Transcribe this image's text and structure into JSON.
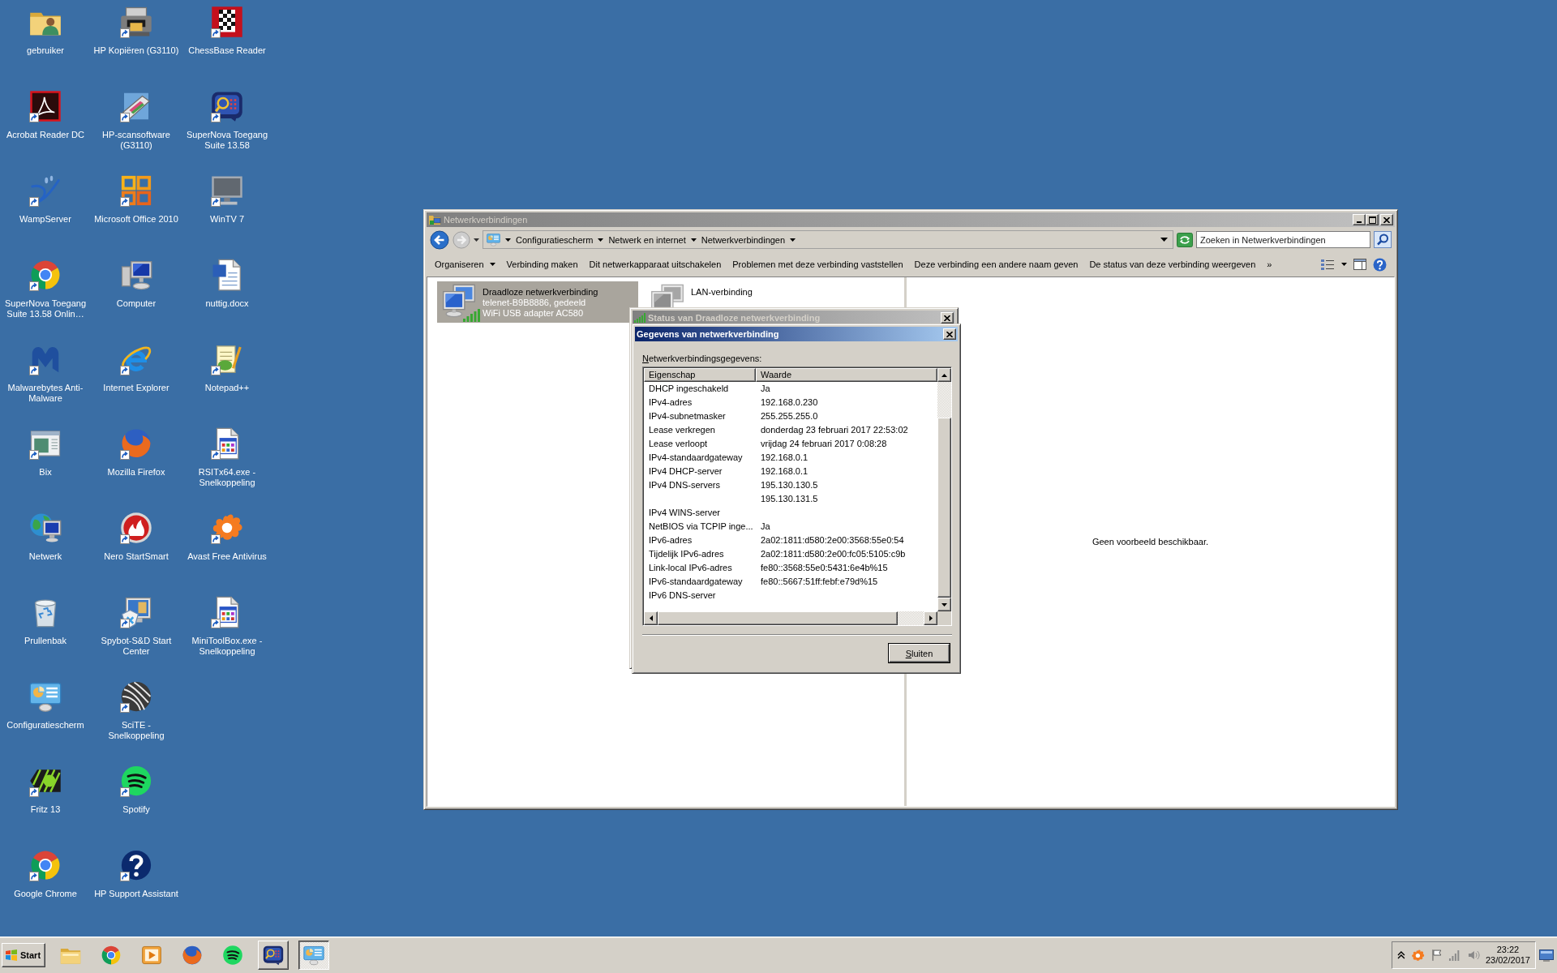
{
  "desktop": {
    "icons": [
      {
        "label": "gebruiker",
        "kind": "folder",
        "shortcut": false
      },
      {
        "label": "Acrobat Reader DC",
        "kind": "pdf",
        "shortcut": true
      },
      {
        "label": "WampServer",
        "kind": "splash",
        "shortcut": true
      },
      {
        "label": "SuperNova Toegang Suite 13.58 Onlin…",
        "kind": "chrome",
        "shortcut": true
      },
      {
        "label": "Malwarebytes Anti-Malware",
        "kind": "malware",
        "shortcut": true
      },
      {
        "label": "Bix",
        "kind": "window",
        "shortcut": true
      },
      {
        "label": "Netwerk",
        "kind": "network",
        "shortcut": false
      },
      {
        "label": "Prullenbak",
        "kind": "trash",
        "shortcut": false
      },
      {
        "label": "Configuratiescherm",
        "kind": "controlpanel",
        "shortcut": false
      },
      {
        "label": "Fritz 13",
        "kind": "fritz",
        "shortcut": true
      },
      {
        "label": "Google Chrome",
        "kind": "chrome",
        "shortcut": true
      },
      {
        "label": "HP Kopiëren (G3110)",
        "kind": "printer",
        "shortcut": true
      },
      {
        "label": "HP-scansoftware (G3110)",
        "kind": "scanner",
        "shortcut": true
      },
      {
        "label": "Microsoft Office 2010",
        "kind": "office",
        "shortcut": true
      },
      {
        "label": "Computer",
        "kind": "computer",
        "shortcut": false
      },
      {
        "label": "Internet Explorer",
        "kind": "ie",
        "shortcut": true
      },
      {
        "label": "Mozilla Firefox",
        "kind": "firefox",
        "shortcut": true
      },
      {
        "label": "Nero StartSmart",
        "kind": "nero",
        "shortcut": true
      },
      {
        "label": "Spybot-S&D Start Center",
        "kind": "spybot",
        "shortcut": true
      },
      {
        "label": "SciTE - Snelkoppeling",
        "kind": "sphere",
        "shortcut": true
      },
      {
        "label": "Spotify",
        "kind": "spotify",
        "shortcut": true
      },
      {
        "label": "HP Support Assistant",
        "kind": "help",
        "shortcut": true
      },
      {
        "label": "ChessBase Reader",
        "kind": "chess",
        "shortcut": true
      },
      {
        "label": "SuperNova Toegang Suite 13.58",
        "kind": "magnifier",
        "shortcut": true
      },
      {
        "label": "WinTV 7",
        "kind": "tv",
        "shortcut": true
      },
      {
        "label": "nuttig.docx",
        "kind": "word",
        "shortcut": false
      },
      {
        "label": "Notepad++",
        "kind": "notepad",
        "shortcut": true
      },
      {
        "label": "RSITx64.exe - Snelkoppeling",
        "kind": "exe",
        "shortcut": true
      },
      {
        "label": "Avast Free Antivirus",
        "kind": "avast",
        "shortcut": true
      },
      {
        "label": "MiniToolBox.exe - Snelkoppeling",
        "kind": "exe",
        "shortcut": true
      }
    ]
  },
  "explorer": {
    "title": "Netwerkverbindingen",
    "active": false,
    "crumbs": [
      "Configuratiescherm",
      "Netwerk en internet",
      "Netwerkverbindingen"
    ],
    "search": {
      "placeholder": "Zoeken in Netwerkverbindingen"
    },
    "commands": [
      {
        "label": "Organiseren",
        "menu": true
      },
      {
        "label": "Verbinding maken",
        "menu": false
      },
      {
        "label": "Dit netwerkapparaat uitschakelen",
        "menu": false
      },
      {
        "label": "Problemen met deze verbinding vaststellen",
        "menu": false
      },
      {
        "label": "Deze verbinding een andere naam geven",
        "menu": false
      },
      {
        "label": "De status van deze verbinding weergeven",
        "menu": false
      }
    ],
    "more": "»",
    "connections": [
      {
        "name": "Draadloze netwerkverbinding",
        "kind": "wireless",
        "details": [
          "telenet-B9B8886, gedeeld",
          "WiFi USB adapter AC580"
        ],
        "selected": true,
        "disabled": false
      },
      {
        "name": "LAN-verbinding",
        "kind": "wired",
        "selected": false,
        "disabled": true
      }
    ],
    "preview_message": "Geen voorbeeld beschikbaar."
  },
  "status_dialog": {
    "title": "Status van Draadloze netwerkverbinding",
    "active": false
  },
  "details_dialog": {
    "title": "Gegevens van netwerkverbinding",
    "active": true,
    "label": "Netwerkverbindingsgegevens:",
    "label_mnemonic": true,
    "columns": [
      "Eigenschap",
      "Waarde"
    ],
    "rows": [
      {
        "property": "DHCP ingeschakeld",
        "value": "Ja"
      },
      {
        "property": "IPv4-adres",
        "value": "192.168.0.230"
      },
      {
        "property": "IPv4-subnetmasker",
        "value": "255.255.255.0"
      },
      {
        "property": "Lease verkregen",
        "value": "donderdag 23 februari 2017 22:53:02"
      },
      {
        "property": "Lease verloopt",
        "value": "vrijdag 24 februari 2017 0:08:28"
      },
      {
        "property": "IPv4-standaardgateway",
        "value": "192.168.0.1"
      },
      {
        "property": "IPv4 DHCP-server",
        "value": "192.168.0.1"
      },
      {
        "property": "IPv4 DNS-servers",
        "value": "195.130.130.5"
      },
      {
        "value": "195.130.131.5"
      },
      {
        "property": "IPv4 WINS-server"
      },
      {
        "property": "NetBIOS via TCPIP inge...",
        "value": "Ja"
      },
      {
        "property": "IPv6-adres",
        "value": "2a02:1811:d580:2e00:3568:55e0:54"
      },
      {
        "property": "Tijdelijk IPv6-adres",
        "value": "2a02:1811:d580:2e00:fc05:5105:c9b"
      },
      {
        "property": "Link-local IPv6-adres",
        "value": "fe80::3568:55e0:5431:6e4b%15"
      },
      {
        "property": "IPv6-standaardgateway",
        "value": "fe80::5667:51ff:febf:e79d%15"
      },
      {
        "property": "IPv6 DNS-server"
      }
    ],
    "button": {
      "label": "Sluiten",
      "mnemonic": true
    }
  },
  "taskbar": {
    "start": "Start",
    "items": [
      {
        "kind": "explorer",
        "running": false,
        "selected": false
      },
      {
        "kind": "chrome",
        "running": false,
        "selected": false
      },
      {
        "kind": "player",
        "running": false,
        "selected": false
      },
      {
        "kind": "firefox",
        "running": false,
        "selected": false
      },
      {
        "kind": "spotify",
        "running": false,
        "selected": false
      },
      {
        "kind": "magnifier",
        "running": true,
        "selected": false
      },
      {
        "kind": "controlpanel",
        "running": true,
        "selected": true
      }
    ],
    "tray": [
      {
        "kind": "chevron"
      },
      {
        "kind": "avast"
      },
      {
        "kind": "flag"
      },
      {
        "kind": "signal"
      },
      {
        "kind": "speaker"
      }
    ],
    "time": "23:22",
    "date": "23/02/2017"
  }
}
